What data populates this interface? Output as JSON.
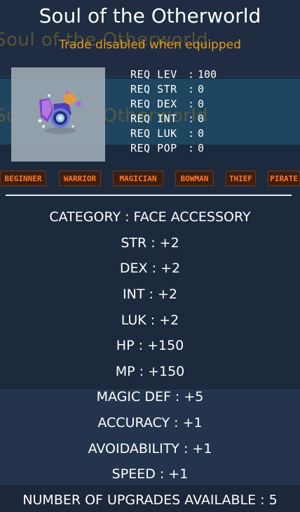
{
  "item": {
    "name": "Soul of the Otherworld",
    "trade_note": "Trade disabled when equipped",
    "icon": "soul-jewel-icon"
  },
  "requirements": [
    {
      "label": "REQ LEV",
      "value": "100"
    },
    {
      "label": "REQ STR",
      "value": "0"
    },
    {
      "label": "REQ DEX",
      "value": "0"
    },
    {
      "label": "REQ INT",
      "value": "0"
    },
    {
      "label": "REQ LUK",
      "value": "0"
    },
    {
      "label": "REQ POP",
      "value": "0"
    }
  ],
  "jobs": [
    "BEGINNER",
    "WARRIOR",
    "MAGICIAN",
    "BOWMAN",
    "THIEF",
    "PIRATE"
  ],
  "stats": {
    "category": "CATEGORY : FACE ACCESSORY",
    "str": "STR : +2",
    "dex": "DEX : +2",
    "int": "INT : +2",
    "luk": "LUK : +2",
    "hp": "HP : +150",
    "mp": "MP : +150",
    "magic_def": "MAGIC DEF : +5",
    "accuracy": "ACCURACY : +1",
    "avoidability": "AVOIDABILITY : +1",
    "speed": "SPEED : +1",
    "upgrades": "NUMBER OF UPGRADES AVAILABLE : 5"
  },
  "colors": {
    "title": "#ffffff",
    "trade_note": "#e99a17",
    "job_text": "#ff7a2a",
    "background": "#1d2a3e"
  }
}
